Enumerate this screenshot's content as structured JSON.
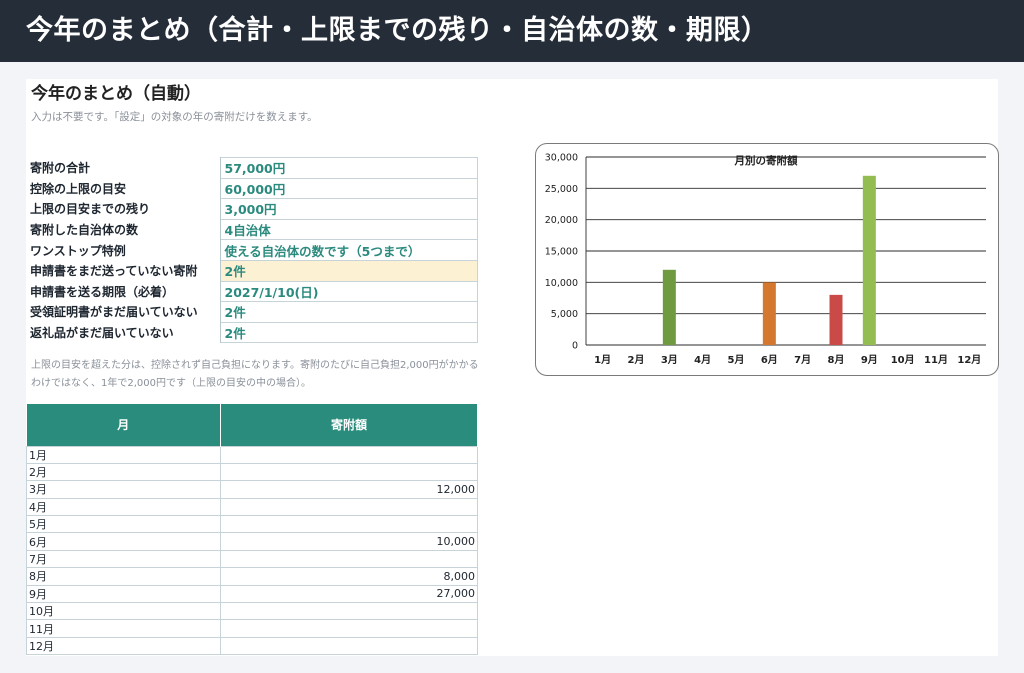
{
  "window": {
    "title": "今年のまとめ（合計・上限までの残り・自治体の数・期限）"
  },
  "sheet": {
    "heading": "今年のまとめ（自動）",
    "note": "入力は不要です。「設定」の対象の年の寄附だけを数えます。",
    "summary": [
      {
        "label": "寄附の合計",
        "value": "57,000円"
      },
      {
        "label": "控除の上限の目安",
        "value": "60,000円"
      },
      {
        "label": "上限の目安までの残り",
        "value": "3,000円"
      },
      {
        "label": "寄附した自治体の数",
        "value": "4自治体"
      },
      {
        "label": "ワンストップ特例",
        "value": "使える自治体の数です（5つまで）"
      },
      {
        "label": "申請書をまだ送っていない寄附",
        "value": "2件",
        "highlight": true
      },
      {
        "label": "申請書を送る期限（必着）",
        "value": "2027/1/10(日)"
      },
      {
        "label": "受領証明書がまだ届いていない",
        "value": "2件"
      },
      {
        "label": "返礼品がまだ届いていない",
        "value": "2件"
      }
    ],
    "footnote": "上限の目安を超えた分は、控除されず自己負担になります。寄附のたびに自己負担2,000円がかかるわけではなく、1年で2,000円です（上限の目安の中の場合）。",
    "monthly_table": {
      "headers": [
        "月",
        "寄附額"
      ],
      "rows": [
        {
          "month": "1月",
          "amount": ""
        },
        {
          "month": "2月",
          "amount": ""
        },
        {
          "month": "3月",
          "amount": "12,000"
        },
        {
          "month": "4月",
          "amount": ""
        },
        {
          "month": "5月",
          "amount": ""
        },
        {
          "month": "6月",
          "amount": "10,000"
        },
        {
          "month": "7月",
          "amount": ""
        },
        {
          "month": "8月",
          "amount": "8,000"
        },
        {
          "month": "9月",
          "amount": "27,000"
        },
        {
          "month": "10月",
          "amount": ""
        },
        {
          "month": "11月",
          "amount": ""
        },
        {
          "month": "12月",
          "amount": ""
        }
      ]
    }
  },
  "chart_data": {
    "type": "bar",
    "title": "月別の寄附額",
    "categories": [
      "1月",
      "2月",
      "3月",
      "4月",
      "5月",
      "6月",
      "7月",
      "8月",
      "9月",
      "10月",
      "11月",
      "12月"
    ],
    "values": [
      0,
      0,
      12000,
      0,
      0,
      10000,
      0,
      8000,
      27000,
      0,
      0,
      0
    ],
    "bar_colors": [
      "#6f9a40",
      "#6f9a40",
      "#6f9a40",
      "#6f9a40",
      "#6f9a40",
      "#d4772f",
      "#d4772f",
      "#c94a46",
      "#93bd50",
      "#93bd50",
      "#93bd50",
      "#93bd50"
    ],
    "ylim": [
      0,
      30000
    ],
    "yticks": [
      "0",
      "5,000",
      "10,000",
      "15,000",
      "20,000",
      "25,000",
      "30,000"
    ],
    "grid": true,
    "xlabel": "",
    "ylabel": ""
  }
}
